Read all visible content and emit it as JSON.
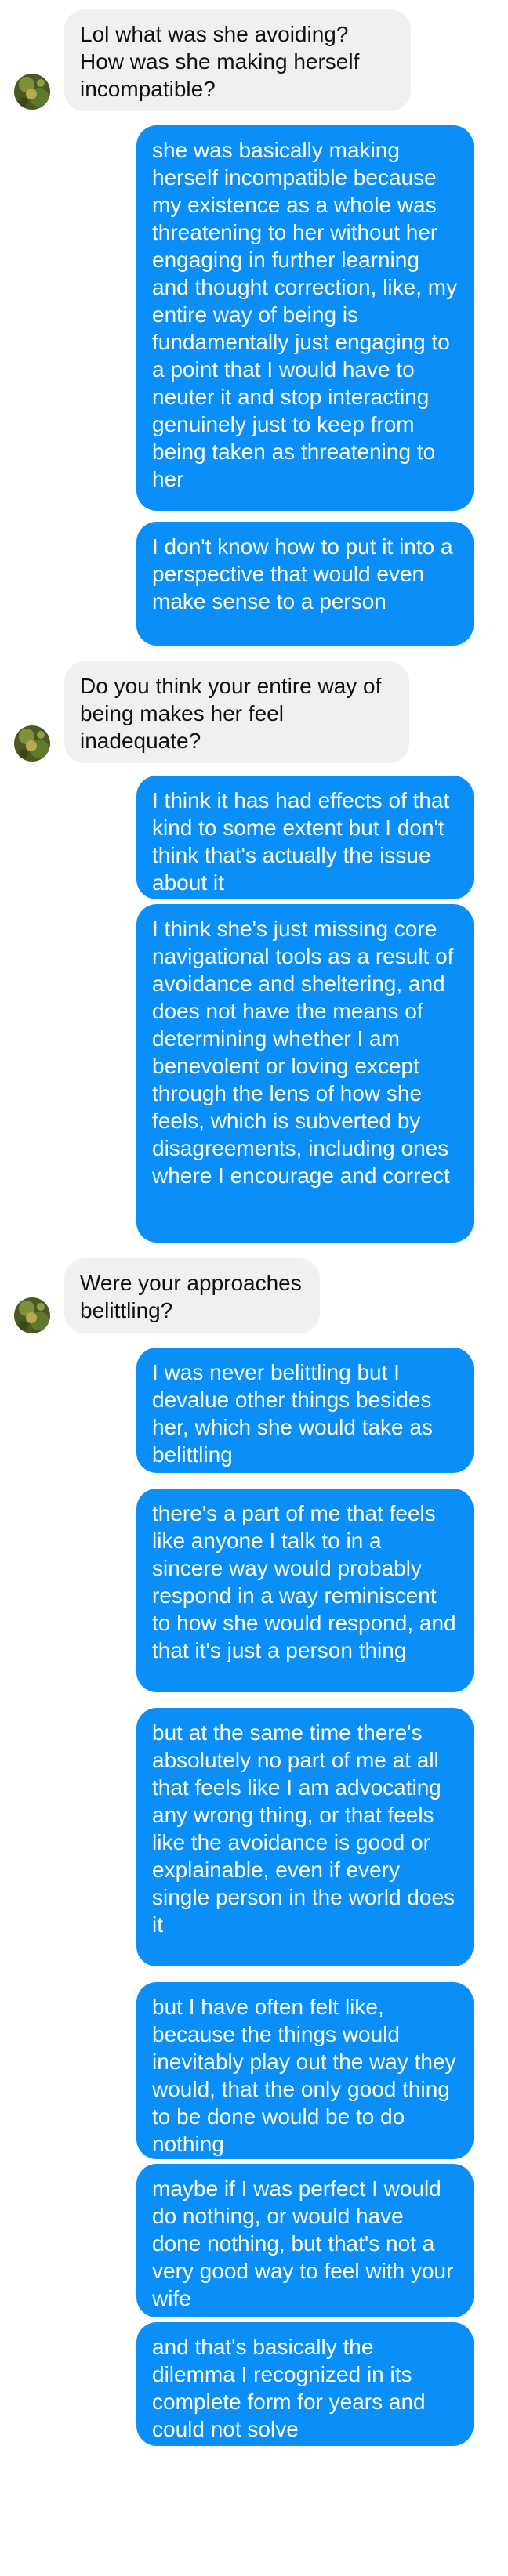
{
  "contact": {
    "avatar_icon": "contact-avatar-plant-photo",
    "bubble_color": "#f0f0f0"
  },
  "me": {
    "bubble_color": "#0a8ef8"
  },
  "messages": [
    {
      "sender": "contact",
      "text": "Lol what was she avoiding? How was she making herself incompatible?"
    },
    {
      "sender": "me",
      "text": "she was basically making herself incompatible because my existence as a whole was threatening to her without her engaging in further learning and thought correction, like, my entire way of being is fundamentally just engaging to a point that I would have to neuter it and stop interacting genuinely just to keep from being taken as threatening to her"
    },
    {
      "sender": "me",
      "text": "I don't know how to put it into a perspective that would even make sense to a person"
    },
    {
      "sender": "contact",
      "text": "Do you think your entire way of being makes her feel inadequate?"
    },
    {
      "sender": "me",
      "text": "I think it has had effects of that kind to some extent but I don't think that's actually the issue about it"
    },
    {
      "sender": "me",
      "text": "I think she's just missing core navigational tools as a result of avoidance and sheltering, and does not have the means of determining whether I am benevolent or loving except through the lens of how she feels, which is subverted by disagreements, including ones where I encourage and correct"
    },
    {
      "sender": "contact",
      "text": "Were your approaches belittling?"
    },
    {
      "sender": "me",
      "text": "I was never belittling but I devalue other things besides her, which she would take as belittling"
    },
    {
      "sender": "me",
      "text": "there's a part of me that feels like anyone I talk to in a sincere way would probably respond in a way reminiscent to how she would respond, and that it's just a person thing"
    },
    {
      "sender": "me",
      "text": "but at the same time there's absolutely no part of me at all that feels like I am advocating any wrong thing, or that feels like the avoidance is good or explainable, even if every single person in the world does it"
    },
    {
      "sender": "me",
      "text": "but I have often felt like, because the things would inevitably play out the way they would, that the only good thing to be done would be to do nothing"
    },
    {
      "sender": "me",
      "text": "maybe if I was perfect I would do nothing, or would have done nothing, but that's not a very good way to feel with your wife"
    },
    {
      "sender": "me",
      "text": "and that's basically the dilemma I recognized in its complete form for years and could not solve"
    }
  ]
}
